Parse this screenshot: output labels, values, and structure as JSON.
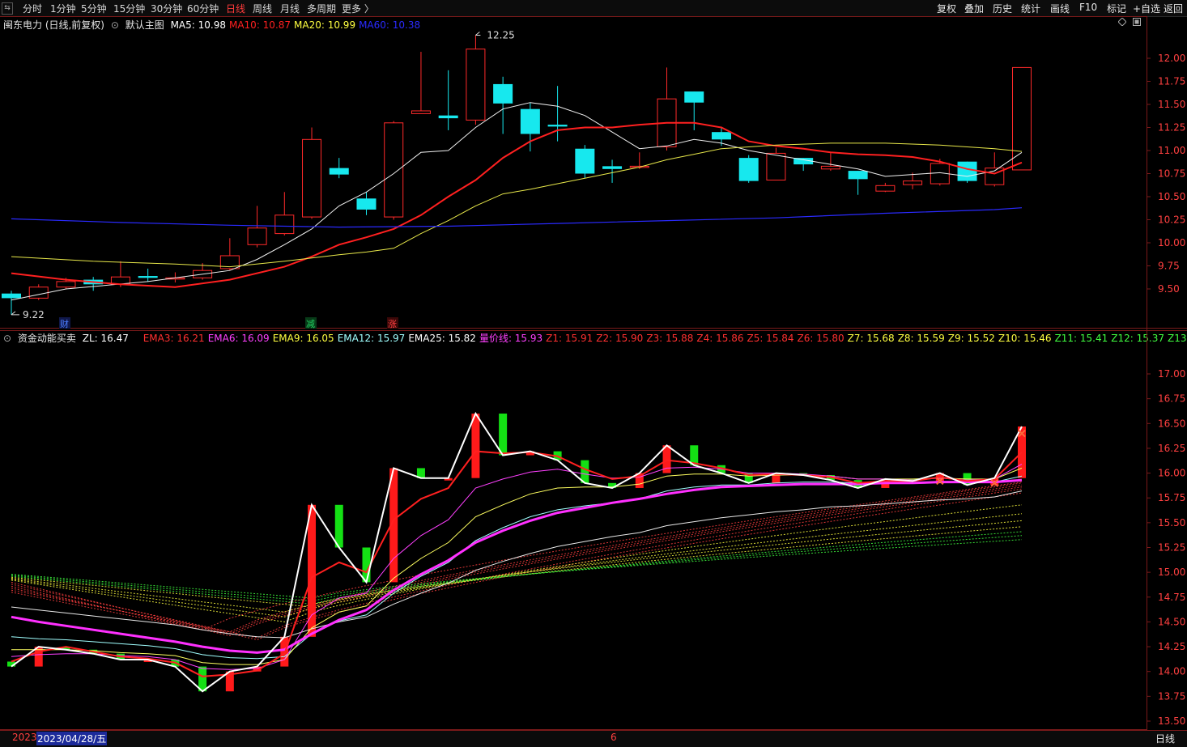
{
  "toolbar": {
    "periods": [
      {
        "label": "分时"
      },
      {
        "label": "1分钟"
      },
      {
        "label": "5分钟"
      },
      {
        "label": "15分钟"
      },
      {
        "label": "30分钟"
      },
      {
        "label": "60分钟"
      },
      {
        "label": "日线"
      },
      {
        "label": "周线"
      },
      {
        "label": "月线"
      },
      {
        "label": "多周期"
      },
      {
        "label": "更多 〉"
      }
    ],
    "actions": [
      {
        "label": "复权"
      },
      {
        "label": "叠加"
      },
      {
        "label": "历史"
      },
      {
        "label": "统计"
      },
      {
        "label": "画线"
      },
      {
        "label": "F10"
      },
      {
        "label": "标记"
      },
      {
        "label": "+自选"
      },
      {
        "label": "返回"
      }
    ]
  },
  "main_chart": {
    "title": "闽东电力 (日线,前复权)",
    "template": "默认主图",
    "ma": [
      {
        "label": "MA5: 10.98",
        "color": "#ffffff"
      },
      {
        "label": "MA10: 10.87",
        "color": "#ff2020"
      },
      {
        "label": "MA20: 10.99",
        "color": "#ffff40"
      },
      {
        "label": "MA60: 10.38",
        "color": "#2a2aff"
      }
    ],
    "y_ticks": [
      "12.00",
      "11.75",
      "11.50",
      "11.25",
      "11.00",
      "10.75",
      "10.50",
      "10.25",
      "10.00",
      "9.75",
      "9.50"
    ],
    "high_label": "12.25",
    "low_label": "9.22",
    "event_marks": [
      "财",
      "减",
      "涨"
    ]
  },
  "sub_chart": {
    "title": "资金动能买卖",
    "zl": "ZL: 16.47",
    "indicators": [
      {
        "label": "EMA3: 16.21",
        "color": "#ff3030"
      },
      {
        "label": "EMA6: 16.09",
        "color": "#ff40ff"
      },
      {
        "label": "EMA9: 16.05",
        "color": "#ffff40"
      },
      {
        "label": "EMA12: 15.97",
        "color": "#a0ffff"
      },
      {
        "label": "EMA25: 15.82",
        "color": "#ffffff"
      },
      {
        "label": "量价线: 15.93",
        "color": "#ff40ff"
      },
      {
        "label": "Z1: 15.91",
        "color": "#ff3030"
      },
      {
        "label": "Z2: 15.90",
        "color": "#ff3030"
      },
      {
        "label": "Z3: 15.88",
        "color": "#ff3030"
      },
      {
        "label": "Z4: 15.86",
        "color": "#ff3030"
      },
      {
        "label": "Z5: 15.84",
        "color": "#ff3030"
      },
      {
        "label": "Z6: 15.80",
        "color": "#ff3030"
      },
      {
        "label": "Z7: 15.68",
        "color": "#ffff40"
      },
      {
        "label": "Z8: 15.59",
        "color": "#ffff40"
      },
      {
        "label": "Z9: 15.52",
        "color": "#ffff40"
      },
      {
        "label": "Z10: 15.46",
        "color": "#ffff40"
      },
      {
        "label": "Z11: 15.41",
        "color": "#40ff40"
      },
      {
        "label": "Z12: 15.37",
        "color": "#40ff40"
      },
      {
        "label": "Z13: 15.33",
        "color": "#40ff40"
      }
    ],
    "y_ticks": [
      "17.00",
      "16.75",
      "16.50",
      "16.25",
      "16.00",
      "15.75",
      "15.50",
      "15.25",
      "15.00",
      "14.75",
      "14.50",
      "14.25",
      "14.00",
      "13.75",
      "13.50"
    ]
  },
  "bottom": {
    "year": "2023",
    "date": "2023/04/28/五",
    "month_mark": "6",
    "period": "日线"
  },
  "colors": {
    "up": "#ff2a2a",
    "down": "#17e8ee",
    "buy": "#ff1a1a",
    "sell": "#14e014"
  },
  "candles": [
    [
      9.45,
      9.4,
      9.48,
      9.22
    ],
    [
      9.4,
      9.52,
      9.55,
      9.38
    ],
    [
      9.52,
      9.58,
      9.62,
      9.5
    ],
    [
      9.6,
      9.55,
      9.63,
      9.48
    ],
    [
      9.55,
      9.63,
      9.8,
      9.52
    ],
    [
      9.64,
      9.62,
      9.72,
      9.58
    ],
    [
      9.62,
      9.62,
      9.68,
      9.57
    ],
    [
      9.62,
      9.7,
      9.78,
      9.6
    ],
    [
      9.72,
      9.86,
      10.05,
      9.7
    ],
    [
      9.98,
      10.16,
      10.4,
      9.95
    ],
    [
      10.1,
      10.3,
      10.55,
      10.08
    ],
    [
      10.28,
      11.12,
      11.25,
      10.26
    ],
    [
      10.81,
      10.74,
      10.92,
      10.7
    ],
    [
      10.48,
      10.36,
      10.55,
      10.3
    ],
    [
      10.28,
      11.3,
      11.32,
      10.25
    ],
    [
      11.4,
      11.43,
      12.07,
      11.4
    ],
    [
      11.38,
      11.35,
      11.87,
      11.22
    ],
    [
      11.33,
      12.1,
      12.25,
      11.28
    ],
    [
      11.72,
      11.51,
      11.8,
      11.18
    ],
    [
      11.45,
      11.18,
      11.52,
      10.99
    ],
    [
      11.28,
      11.26,
      11.7,
      11.1
    ],
    [
      11.02,
      10.75,
      11.06,
      10.7
    ],
    [
      10.83,
      10.8,
      10.9,
      10.65
    ],
    [
      10.82,
      10.83,
      10.98,
      10.8
    ],
    [
      11.04,
      11.56,
      11.9,
      11.0
    ],
    [
      11.64,
      11.52,
      11.64,
      11.22
    ],
    [
      11.2,
      11.12,
      11.25,
      11.05
    ],
    [
      10.92,
      10.67,
      10.95,
      10.65
    ],
    [
      10.68,
      10.97,
      11.03,
      10.68
    ],
    [
      10.92,
      10.85,
      10.92,
      10.78
    ],
    [
      10.8,
      10.83,
      10.98,
      10.78
    ],
    [
      10.78,
      10.69,
      10.78,
      10.52
    ],
    [
      10.56,
      10.62,
      10.65,
      10.55
    ],
    [
      10.63,
      10.67,
      10.76,
      10.58
    ],
    [
      10.64,
      10.86,
      10.91,
      10.62
    ],
    [
      10.88,
      10.67,
      10.88,
      10.65
    ],
    [
      10.63,
      10.81,
      10.98,
      10.61
    ],
    [
      10.79,
      11.9,
      11.9,
      10.79
    ]
  ],
  "ma_series": {
    "ma5": [
      [
        0,
        9.38
      ],
      [
        2,
        9.5
      ],
      [
        5,
        9.58
      ],
      [
        8,
        9.7
      ],
      [
        9,
        9.82
      ],
      [
        10,
        9.98
      ],
      [
        11,
        10.15
      ],
      [
        12,
        10.4
      ],
      [
        13,
        10.55
      ],
      [
        14,
        10.75
      ],
      [
        15,
        10.98
      ],
      [
        16,
        11.0
      ],
      [
        17,
        11.25
      ],
      [
        18,
        11.45
      ],
      [
        19,
        11.52
      ],
      [
        20,
        11.48
      ],
      [
        21,
        11.38
      ],
      [
        22,
        11.2
      ],
      [
        23,
        11.02
      ],
      [
        24,
        11.05
      ],
      [
        25,
        11.12
      ],
      [
        26,
        11.08
      ],
      [
        27,
        11.0
      ],
      [
        28,
        10.95
      ],
      [
        29,
        10.9
      ],
      [
        30,
        10.85
      ],
      [
        31,
        10.8
      ],
      [
        32,
        10.72
      ],
      [
        33,
        10.74
      ],
      [
        34,
        10.76
      ],
      [
        35,
        10.72
      ],
      [
        36,
        10.78
      ],
      [
        37,
        10.98
      ]
    ],
    "ma10": [
      [
        0,
        9.67
      ],
      [
        2,
        9.6
      ],
      [
        4,
        9.55
      ],
      [
        6,
        9.52
      ],
      [
        8,
        9.6
      ],
      [
        10,
        9.74
      ],
      [
        11,
        9.85
      ],
      [
        12,
        9.98
      ],
      [
        13,
        10.06
      ],
      [
        14,
        10.15
      ],
      [
        15,
        10.3
      ],
      [
        16,
        10.5
      ],
      [
        17,
        10.68
      ],
      [
        18,
        10.92
      ],
      [
        19,
        11.1
      ],
      [
        20,
        11.22
      ],
      [
        21,
        11.25
      ],
      [
        22,
        11.25
      ],
      [
        23,
        11.28
      ],
      [
        24,
        11.3
      ],
      [
        25,
        11.3
      ],
      [
        26,
        11.25
      ],
      [
        27,
        11.1
      ],
      [
        28,
        11.05
      ],
      [
        29,
        11.02
      ],
      [
        30,
        10.98
      ],
      [
        31,
        10.96
      ],
      [
        32,
        10.95
      ],
      [
        33,
        10.93
      ],
      [
        34,
        10.88
      ],
      [
        35,
        10.8
      ],
      [
        36,
        10.75
      ],
      [
        37,
        10.87
      ]
    ],
    "ma20": [
      [
        0,
        9.85
      ],
      [
        3,
        9.8
      ],
      [
        6,
        9.77
      ],
      [
        8,
        9.74
      ],
      [
        10,
        9.8
      ],
      [
        12,
        9.87
      ],
      [
        13,
        9.9
      ],
      [
        14,
        9.94
      ],
      [
        15,
        10.1
      ],
      [
        16,
        10.24
      ],
      [
        17,
        10.4
      ],
      [
        18,
        10.53
      ],
      [
        19,
        10.58
      ],
      [
        20,
        10.64
      ],
      [
        21,
        10.7
      ],
      [
        22,
        10.76
      ],
      [
        23,
        10.82
      ],
      [
        24,
        10.9
      ],
      [
        25,
        10.96
      ],
      [
        26,
        11.02
      ],
      [
        28,
        11.06
      ],
      [
        30,
        11.08
      ],
      [
        32,
        11.08
      ],
      [
        34,
        11.06
      ],
      [
        36,
        11.02
      ],
      [
        37,
        10.99
      ]
    ],
    "ma60": [
      [
        0,
        10.26
      ],
      [
        4,
        10.22
      ],
      [
        8,
        10.19
      ],
      [
        12,
        10.17
      ],
      [
        16,
        10.18
      ],
      [
        20,
        10.21
      ],
      [
        24,
        10.24
      ],
      [
        28,
        10.27
      ],
      [
        32,
        10.32
      ],
      [
        36,
        10.36
      ],
      [
        37,
        10.38
      ]
    ]
  },
  "zl": [
    14.05,
    14.25,
    14.22,
    14.18,
    14.12,
    14.12,
    14.05,
    13.8,
    14.0,
    14.05,
    14.35,
    15.68,
    15.25,
    14.9,
    16.05,
    15.95,
    15.95,
    16.6,
    16.18,
    16.22,
    16.13,
    15.9,
    15.85,
    16.0,
    16.28,
    16.08,
    16.0,
    15.9,
    16.0,
    15.98,
    15.93,
    15.85,
    15.94,
    15.92,
    16.0,
    15.88,
    15.95,
    16.47
  ],
  "prev_zl": 14.1,
  "ema3": [
    14.1,
    14.2,
    14.25,
    14.2,
    14.15,
    14.13,
    14.09,
    13.95,
    13.97,
    14.01,
    14.18,
    14.95,
    15.1,
    15.0,
    15.53,
    15.74,
    15.85,
    16.22,
    16.2,
    16.21,
    16.17,
    16.04,
    15.94,
    15.97,
    16.13,
    16.1,
    16.05,
    15.98,
    15.99,
    15.98,
    15.96,
    15.9,
    15.92,
    15.92,
    15.96,
    15.92,
    15.94,
    16.21
  ],
  "ema6": [
    14.15,
    14.17,
    14.18,
    14.18,
    14.16,
    14.15,
    14.12,
    14.03,
    14.02,
    14.03,
    14.12,
    14.57,
    14.74,
    14.79,
    15.14,
    15.37,
    15.53,
    15.85,
    15.94,
    16.01,
    16.04,
    15.99,
    15.95,
    15.96,
    16.05,
    16.06,
    16.04,
    16.0,
    16.0,
    15.99,
    15.97,
    15.94,
    15.94,
    15.93,
    15.95,
    15.93,
    15.94,
    16.09
  ],
  "ema9": [
    14.22,
    14.22,
    14.22,
    14.21,
    14.19,
    14.18,
    14.16,
    14.09,
    14.07,
    14.07,
    14.12,
    14.44,
    14.6,
    14.66,
    14.94,
    15.14,
    15.3,
    15.56,
    15.68,
    15.79,
    15.85,
    15.86,
    15.86,
    15.89,
    15.97,
    15.99,
    15.99,
    15.97,
    15.98,
    15.98,
    15.97,
    15.94,
    15.94,
    15.94,
    15.95,
    15.94,
    15.94,
    16.05
  ],
  "ema12": [
    14.35,
    14.33,
    14.32,
    14.3,
    14.28,
    14.26,
    14.23,
    14.17,
    14.14,
    14.13,
    14.15,
    14.38,
    14.51,
    14.57,
    14.79,
    14.96,
    15.1,
    15.32,
    15.45,
    15.56,
    15.63,
    15.67,
    15.7,
    15.74,
    15.82,
    15.86,
    15.88,
    15.88,
    15.9,
    15.91,
    15.91,
    15.9,
    15.9,
    15.9,
    15.91,
    15.91,
    15.91,
    15.97
  ],
  "vp": [
    14.55,
    14.5,
    14.46,
    14.42,
    14.38,
    14.34,
    14.3,
    14.25,
    14.21,
    14.19,
    14.22,
    14.38,
    14.52,
    14.62,
    14.82,
    14.98,
    15.12,
    15.3,
    15.42,
    15.52,
    15.6,
    15.65,
    15.7,
    15.74,
    15.79,
    15.83,
    15.86,
    15.87,
    15.88,
    15.89,
    15.89,
    15.89,
    15.9,
    15.9,
    15.91,
    15.91,
    15.91,
    15.93
  ],
  "ema25": [
    14.65,
    14.62,
    14.59,
    14.56,
    14.53,
    14.5,
    14.47,
    14.42,
    14.38,
    14.35,
    14.34,
    14.43,
    14.5,
    14.55,
    14.68,
    14.79,
    14.89,
    15.02,
    15.11,
    15.19,
    15.26,
    15.31,
    15.36,
    15.4,
    15.47,
    15.51,
    15.55,
    15.58,
    15.61,
    15.63,
    15.66,
    15.67,
    15.69,
    15.71,
    15.73,
    15.74,
    15.76,
    15.82
  ],
  "z_end": [
    15.91,
    15.9,
    15.88,
    15.86,
    15.84,
    15.8,
    15.68,
    15.59,
    15.52,
    15.46,
    15.41,
    15.37,
    15.33
  ],
  "z_start": [
    14.8,
    14.82,
    14.84,
    14.86,
    14.88,
    14.9,
    14.92,
    14.93,
    14.94,
    14.95,
    14.96,
    14.97,
    14.98
  ],
  "z_low": [
    14.42,
    14.4,
    14.38,
    14.36,
    14.34,
    14.32,
    14.5,
    14.55,
    14.6,
    14.65,
    14.68,
    14.71,
    14.74
  ],
  "z_low_i": [
    7,
    8,
    8,
    8,
    9,
    9,
    10,
    10,
    10,
    11,
    11,
    11,
    11
  ]
}
